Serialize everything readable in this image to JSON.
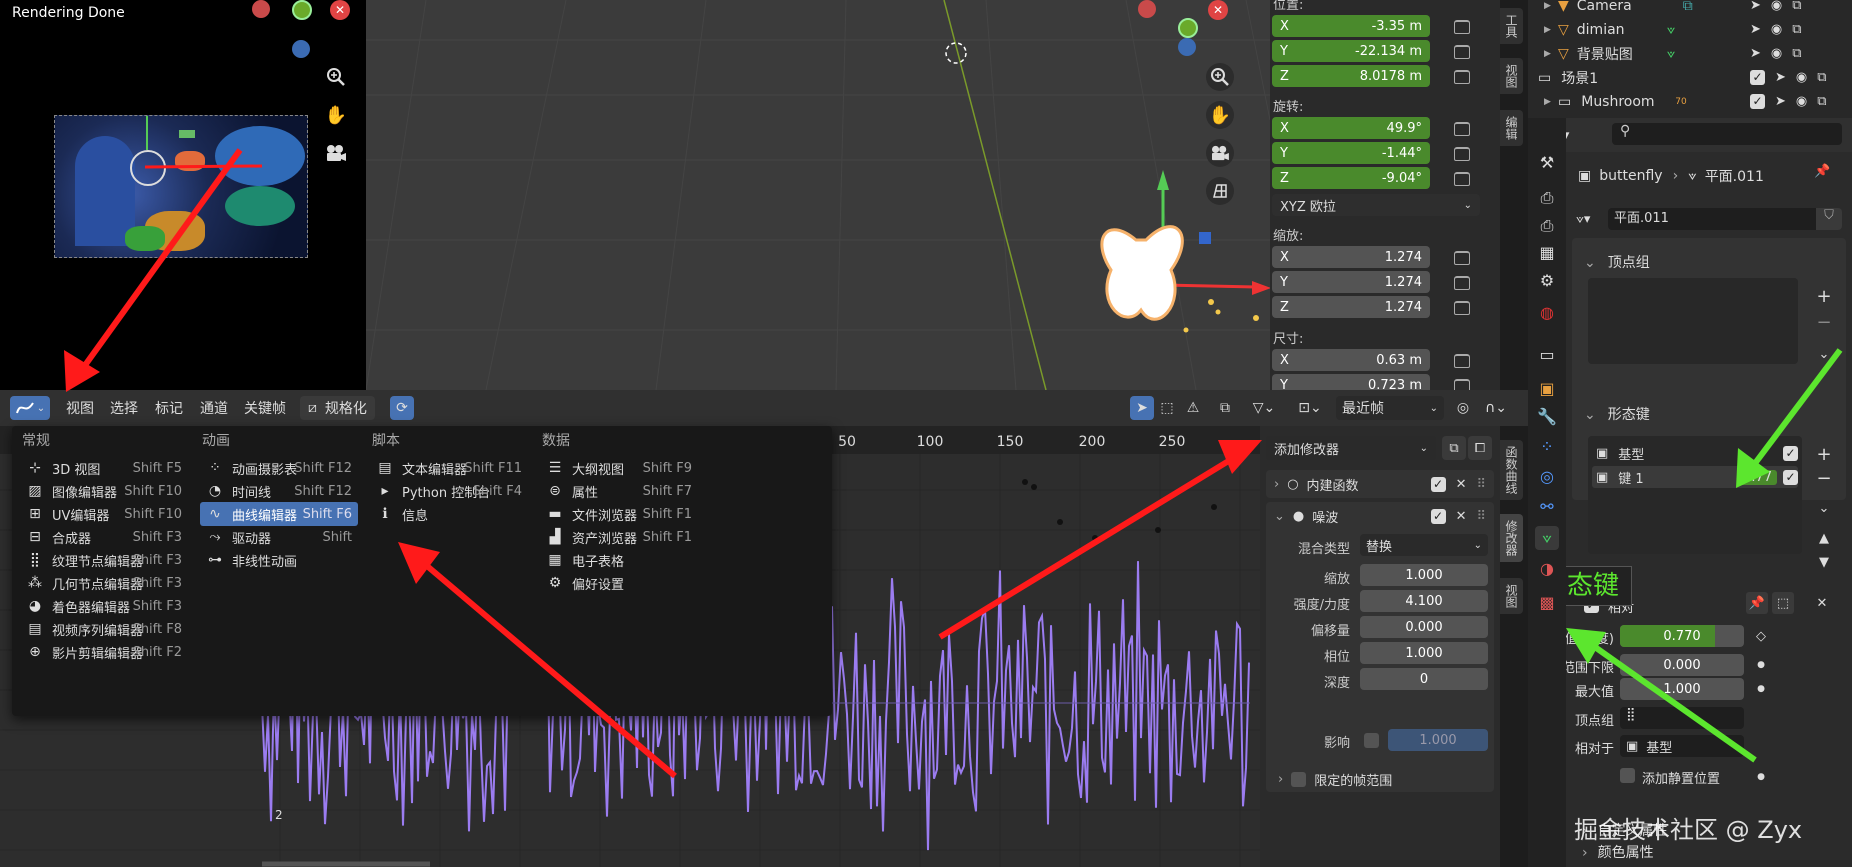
{
  "render": {
    "status": "Rendering Done"
  },
  "transform": {
    "location_label": "位置:",
    "location": [
      {
        "axis": "X",
        "value": "-3.35 m"
      },
      {
        "axis": "Y",
        "value": "-22.134 m"
      },
      {
        "axis": "Z",
        "value": "8.0178 m"
      }
    ],
    "rotation_label": "旋转:",
    "rotation": [
      {
        "axis": "X",
        "value": "49.9°"
      },
      {
        "axis": "Y",
        "value": "-1.44°"
      },
      {
        "axis": "Z",
        "value": "-9.04°"
      }
    ],
    "rotation_mode": "XYZ 欧拉",
    "scale_label": "缩放:",
    "scale": [
      {
        "axis": "X",
        "value": "1.274"
      },
      {
        "axis": "Y",
        "value": "1.274"
      },
      {
        "axis": "Z",
        "value": "1.274"
      }
    ],
    "dimensions_label": "尺寸:",
    "dimensions": [
      {
        "axis": "X",
        "value": "0.63 m"
      },
      {
        "axis": "Y",
        "value": "0.723 m"
      }
    ]
  },
  "viewport_tabs": [
    "工具",
    "视图",
    "编辑"
  ],
  "graph_tabs": [
    "函数曲线",
    "修改器",
    "视图"
  ],
  "outliner": {
    "rows": [
      {
        "name": "Camera"
      },
      {
        "name": "dimian"
      },
      {
        "name": "背景贴图"
      },
      {
        "name": "场景1"
      },
      {
        "name": "Mushroom",
        "badge": "70"
      }
    ]
  },
  "properties": {
    "object_name": "buttenfly",
    "mesh_name": "平面.011",
    "data_name": "平面.011",
    "vertex_groups_label": "顶点组",
    "shape_keys_label": "形态键",
    "shape_keys": [
      {
        "name": "基型",
        "value": ""
      },
      {
        "name": "键 1",
        "value": "0.77"
      }
    ],
    "annotation": "形态键",
    "relative_label": "相对",
    "value_label": "值(明度)",
    "value": "0.770",
    "value_fraction": 0.77,
    "range_min_label": "范围下限",
    "range_min": "0.000",
    "max_label": "最大值",
    "max": "1.000",
    "vgroup_label": "顶点组",
    "relative_to_label": "相对于",
    "relative_to": "基型",
    "add_rest_label": "添加静置位置",
    "custom_props_label": "自定义属性",
    "color_attr_label": "颜色属性",
    "watermark": "掘金技术社区 @ Zyx"
  },
  "graph_header": {
    "menus": [
      "视图",
      "选择",
      "标记",
      "通道",
      "关键帧"
    ],
    "normalize": "规格化",
    "snap": "最近帧"
  },
  "graph": {
    "frames": [
      "50",
      "100",
      "150",
      "200",
      "250"
    ],
    "channel_marker": "2"
  },
  "menu": {
    "columns": [
      {
        "title": "常规",
        "items": [
          {
            "icon": "3d-view-icon",
            "label": "3D 视图",
            "shortcut": "Shift F5"
          },
          {
            "icon": "image-icon",
            "label": "图像编辑器",
            "shortcut": "Shift F10"
          },
          {
            "icon": "uv-icon",
            "label": "UV编辑器",
            "shortcut": "Shift F10"
          },
          {
            "icon": "compositor-icon",
            "label": "合成器",
            "shortcut": "Shift F3"
          },
          {
            "icon": "texture-nodes-icon",
            "label": "纹理节点编辑器",
            "shortcut": "Shift F3"
          },
          {
            "icon": "geometry-nodes-icon",
            "label": "几何节点编辑器",
            "shortcut": "Shift F3"
          },
          {
            "icon": "shader-icon",
            "label": "着色器编辑器",
            "shortcut": "Shift F3"
          },
          {
            "icon": "sequencer-icon",
            "label": "视频序列编辑器",
            "shortcut": "Shift F8"
          },
          {
            "icon": "clip-icon",
            "label": "影片剪辑编辑器",
            "shortcut": "Shift F2"
          }
        ]
      },
      {
        "title": "动画",
        "items": [
          {
            "icon": "dopesheet-icon",
            "label": "动画摄影表",
            "shortcut": "Shift F12"
          },
          {
            "icon": "timeline-icon",
            "label": "时间线",
            "shortcut": "Shift F12"
          },
          {
            "icon": "graph-icon",
            "label": "曲线编辑器",
            "shortcut": "Shift F6",
            "selected": true
          },
          {
            "icon": "drivers-icon",
            "label": "驱动器",
            "shortcut": "Shift"
          },
          {
            "icon": "nla-icon",
            "label": "非线性动画",
            "shortcut": ""
          }
        ]
      },
      {
        "title": "脚本",
        "items": [
          {
            "icon": "text-icon",
            "label": "文本编辑器",
            "shortcut": "Shift F11"
          },
          {
            "icon": "console-icon",
            "label": "Python 控制台",
            "shortcut": "Shift F4"
          },
          {
            "icon": "info-icon",
            "label": "信息",
            "shortcut": ""
          }
        ]
      },
      {
        "title": "数据",
        "items": [
          {
            "icon": "outliner-icon",
            "label": "大纲视图",
            "shortcut": "Shift F9"
          },
          {
            "icon": "properties-icon",
            "label": "属性",
            "shortcut": "Shift F7"
          },
          {
            "icon": "file-browser-icon",
            "label": "文件浏览器",
            "shortcut": "Shift F1"
          },
          {
            "icon": "asset-browser-icon",
            "label": "资产浏览器",
            "shortcut": "Shift F1"
          },
          {
            "icon": "spreadsheet-icon",
            "label": "电子表格",
            "shortcut": ""
          },
          {
            "icon": "preferences-icon",
            "label": "偏好设置",
            "shortcut": ""
          }
        ]
      }
    ]
  },
  "modifiers": {
    "add_label": "添加修改器",
    "builtin_label": "内建函数",
    "noise_label": "噪波",
    "blend_label": "混合类型",
    "blend_value": "替换",
    "fields": [
      {
        "label": "缩放",
        "value": "1.000"
      },
      {
        "label": "强度/力度",
        "value": "4.100"
      },
      {
        "label": "偏移量",
        "value": "0.000"
      },
      {
        "label": "相位",
        "value": "1.000"
      },
      {
        "label": "深度",
        "value": "0"
      }
    ],
    "influence_label": "影响",
    "influence_value": "1.000",
    "frame_range_label": "限定的帧范围"
  },
  "colors": {
    "accent": "#4772b3",
    "green_field": "#4a8a2c",
    "curve": "#9b7cf0",
    "arrow_red": "#ff1a1a",
    "arrow_green": "#5ce62e"
  }
}
